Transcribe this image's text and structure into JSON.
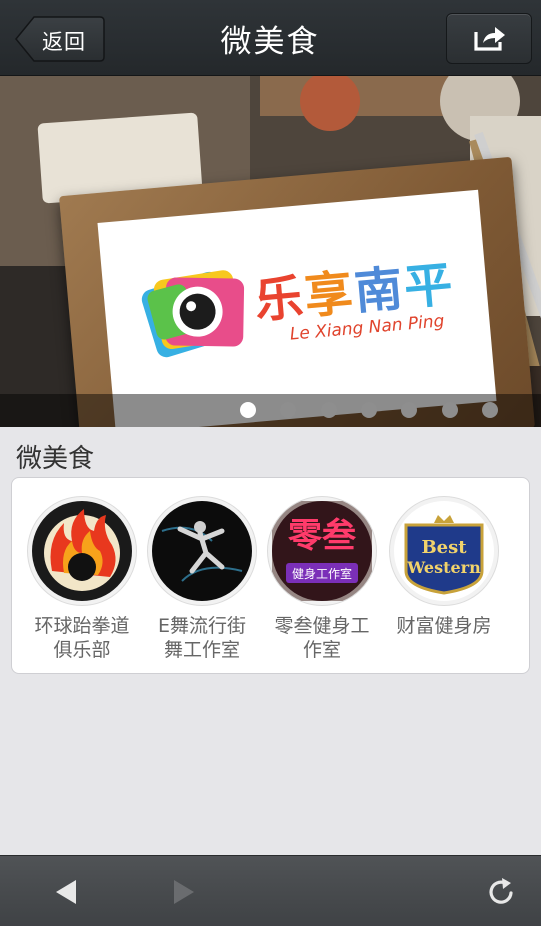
{
  "header": {
    "back_label": "返回",
    "title": "微美食"
  },
  "banner": {
    "logo_text": [
      "乐",
      "享",
      "南",
      "平"
    ],
    "logo_subtitle": "Le Xiang Nan Ping",
    "slide_count": 7,
    "active_slide": 0
  },
  "section": {
    "title": "微美食",
    "items": [
      {
        "label_line1": "环球跆拳道",
        "label_line2": "俱乐部",
        "icon": "taekwondo-flame-logo"
      },
      {
        "label_line1": "E舞流行街",
        "label_line2": "舞工作室",
        "icon": "street-dancer-logo"
      },
      {
        "label_line1": "零叁健身工",
        "label_line2": "作室",
        "icon": "neon-sign-logo",
        "sign_big": "零叁",
        "sign_small": "健身工作室"
      },
      {
        "label_line1": "财富健身房",
        "label_line2": "",
        "icon": "best-western-logo",
        "logo_line1": "Best",
        "logo_line2": "Western"
      }
    ]
  },
  "colors": {
    "topbar": "#2a2e31",
    "page_bg": "#e6e6e9",
    "bottombar": "#47494c"
  }
}
